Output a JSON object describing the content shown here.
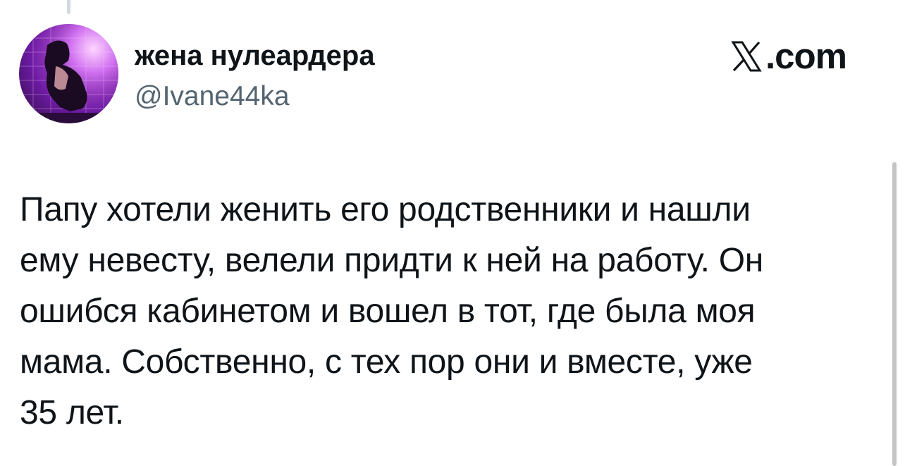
{
  "author": {
    "display_name": "жена нулеардера",
    "handle": "@Ivane44ka",
    "avatar_icon": "avatar-photo"
  },
  "brand": {
    "logo_icon": "x-logo-icon",
    "domain": ".com"
  },
  "tweet": {
    "lines": [
      "Папу хотели женить его родственники и нашли",
      "ему невесту, велели придти к ней на работу. Он",
      "ошибся кабинетом и вошел в тот, где была моя",
      "мама. Собственно, с тех пор они и вместе, уже",
      "35 лет."
    ]
  },
  "colors": {
    "text": "#0f1419",
    "secondary_text": "#536471",
    "background": "#ffffff"
  }
}
